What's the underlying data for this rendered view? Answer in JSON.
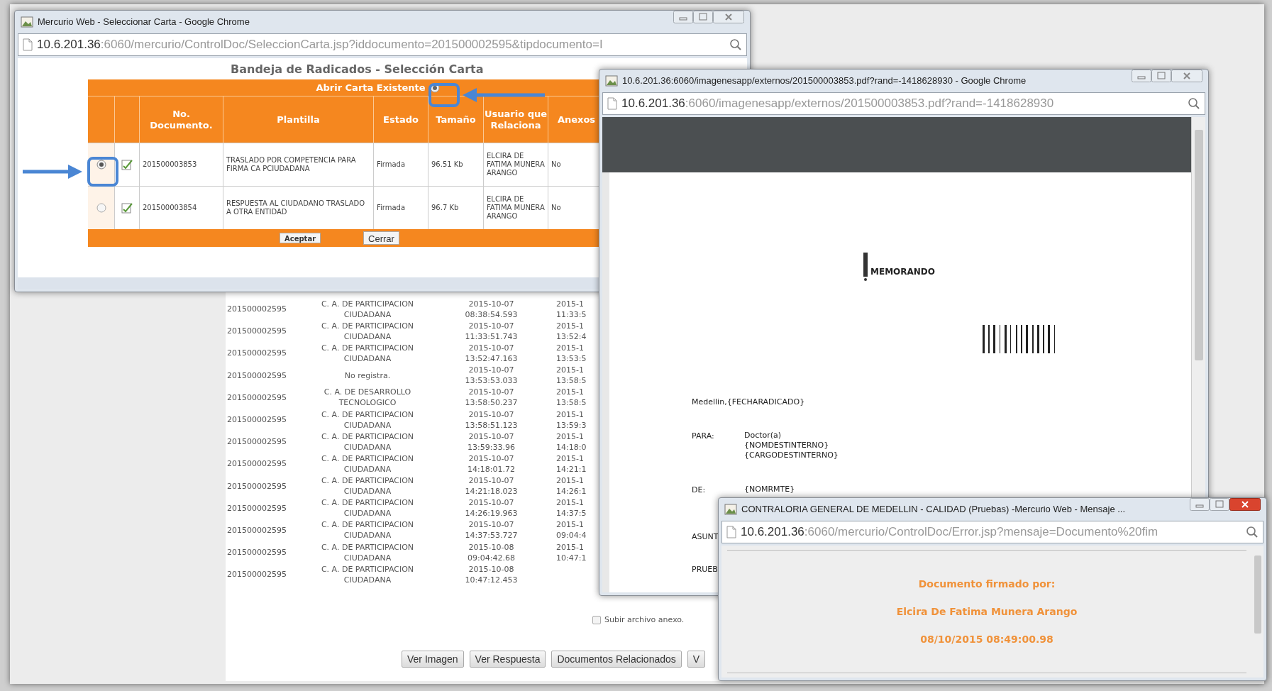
{
  "background_page": {
    "rows": [
      {
        "document": "201500002595",
        "dependency": "C. A. DE PARTICIPACION CIUDADANA",
        "column_3": "2015-10-07 08:38:54.593",
        "column_4": "2015-1 11:33:5"
      },
      {
        "document": "201500002595",
        "dependency": "C. A. DE PARTICIPACION CIUDADANA",
        "column_3": "2015-10-07 11:33:51.743",
        "column_4": "2015-1 13:52:4"
      },
      {
        "document": "201500002595",
        "dependency": "C. A. DE PARTICIPACION CIUDADANA",
        "column_3": "2015-10-07 13:52:47.163",
        "column_4": "2015-1 13:53:5"
      },
      {
        "document": "201500002595",
        "dependency": "No registra.",
        "column_3": "2015-10-07 13:53:53.033",
        "column_4": "2015-1 13:58:5"
      },
      {
        "document": "201500002595",
        "dependency": "C. A. DE DESARROLLO TECNOLOGICO",
        "column_3": "2015-10-07 13:58:50.237",
        "column_4": "2015-1 13:58:5"
      },
      {
        "document": "201500002595",
        "dependency": "C. A. DE PARTICIPACION CIUDADANA",
        "column_3": "2015-10-07 13:58:51.123",
        "column_4": "2015-1 13:59:3"
      },
      {
        "document": "201500002595",
        "dependency": "C. A. DE PARTICIPACION CIUDADANA",
        "column_3": "2015-10-07 13:59:33.96",
        "column_4": "2015-1 14:18:0"
      },
      {
        "document": "201500002595",
        "dependency": "C. A. DE PARTICIPACION CIUDADANA",
        "column_3": "2015-10-07 14:18:01.72",
        "column_4": "2015-1 14:21:1"
      },
      {
        "document": "201500002595",
        "dependency": "C. A. DE PARTICIPACION CIUDADANA",
        "column_3": "2015-10-07 14:21:18.023",
        "column_4": "2015-1 14:26:1"
      },
      {
        "document": "201500002595",
        "dependency": "C. A. DE PARTICIPACION CIUDADANA",
        "column_3": "2015-10-07 14:26:19.963",
        "column_4": "2015-1 14:37:5"
      },
      {
        "document": "201500002595",
        "dependency": "C. A. DE PARTICIPACION CIUDADANA",
        "column_3": "2015-10-07 14:37:53.727",
        "column_4": "2015-1 09:04:4"
      },
      {
        "document": "201500002595",
        "dependency": "C. A. DE PARTICIPACION CIUDADANA",
        "column_3": "2015-10-08 09:04:42.68",
        "column_4": "2015-1 10:47:1"
      },
      {
        "document": "201500002595",
        "dependency": "C. A. DE PARTICIPACION CIUDADANA",
        "column_3": "2015-10-08 10:47:12.453"
      }
    ],
    "attach_checkbox": {
      "label": "Subir archivo anexo.",
      "checked": false
    },
    "buttons": [
      "Ver Imagen",
      "Ver Respuesta",
      "Documentos Relacionados",
      "V"
    ]
  },
  "select_window": {
    "title": "Mercurio Web - Seleccionar Carta - Google Chrome",
    "url_host": "10.6.201.36",
    "url_path": ":6060/mercurio/ControlDoc/SeleccionCarta.jsp?iddocumento=201500002595&tipdocumento=I",
    "heading": "Bandeja de Radicados - Selección Carta",
    "bar_title": "Abrir Carta Existente",
    "columns": [
      "No. Documento.",
      "Plantilla",
      "Estado",
      "Tamaño",
      "Usuario que Relaciona",
      "Anexos"
    ],
    "rows": [
      {
        "selected": true,
        "no_documento": "201500003853",
        "plantilla": "TRASLADO POR COMPETENCIA PARA FIRMA CA PCIUDADANA",
        "estado": "Firmada",
        "tamano": "96.51 Kb",
        "usuario": "ELCIRA DE FATIMA MUNERA ARANGO",
        "anexos": "No"
      },
      {
        "selected": false,
        "no_documento": "201500003854",
        "plantilla": "RESPUESTA AL CIUDADANO TRASLADO A OTRA ENTIDAD",
        "estado": "Firmada",
        "tamano": "96.7 Kb",
        "usuario": "ELCIRA DE FATIMA MUNERA ARANGO",
        "anexos": "No"
      }
    ],
    "buttons": [
      "Aceptar",
      "Cerrar"
    ]
  },
  "pdf_window": {
    "title": "10.6.201.36:6060/imagenesapp/externos/201500003853.pdf?rand=-1418628930 - Google Chrome",
    "url_host": "10.6.201.36",
    "url_path": ":6060/imagenesapp/externos/201500003853.pdf?rand=-1418628930",
    "logo_text": "MEMORANDO",
    "city_line": "Medellin,{FECHARADICADO}",
    "fields": [
      {
        "label": "PARA:",
        "lines": [
          "Doctor(a)",
          "{NOMDESTINTERNO}",
          "{CARGODESTINTERNO}"
        ]
      },
      {
        "label": "DE:",
        "lines": [
          "{NOMRMTE}"
        ]
      },
      {
        "label": "ASUNT"
      },
      {
        "label": "PRUEB"
      }
    ]
  },
  "message_window": {
    "title": "CONTRALORIA GENERAL DE MEDELLIN - CALIDAD (Pruebas) -Mercurio Web - Mensaje ...",
    "url_host": "10.6.201.36",
    "url_path": ":6060/mercurio/ControlDoc/Error.jsp?mensaje=Documento%20fim",
    "lines": [
      "Documento firmado por:",
      "Elcira De Fatima Munera Arango",
      "08/10/2015 08:49:00.98"
    ]
  }
}
